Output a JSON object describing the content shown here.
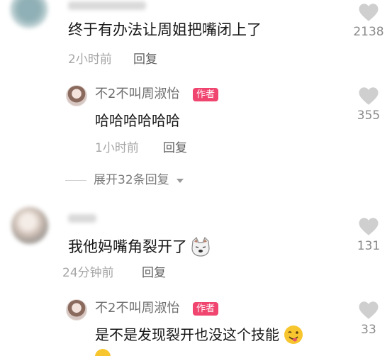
{
  "comments": [
    {
      "text": "终于有办法让周姐把嘴闭上了",
      "time": "2小时前",
      "reply_label": "回复",
      "likes": "2138",
      "replies": [
        {
          "author": "不2不叫周淑怡",
          "badge": "作者",
          "text": "哈哈哈哈哈哈",
          "time": "1小时前",
          "reply_label": "回复",
          "likes": "355"
        }
      ],
      "expand_label": "展开32条回复"
    },
    {
      "text": "我他妈嘴角裂开了",
      "emoji": "cat-face-emoji",
      "time": "24分钟前",
      "reply_label": "回复",
      "likes": "131",
      "replies": [
        {
          "author": "不2不叫周淑怡",
          "badge": "作者",
          "text": "是不是发现裂开也没这个技能",
          "emoji": "winking-tongue-face-emoji",
          "likes": "33"
        }
      ]
    }
  ],
  "colors": {
    "badge": "#f0456f",
    "meta": "#a6a6a6",
    "like_icon": "#cfcfcf"
  }
}
